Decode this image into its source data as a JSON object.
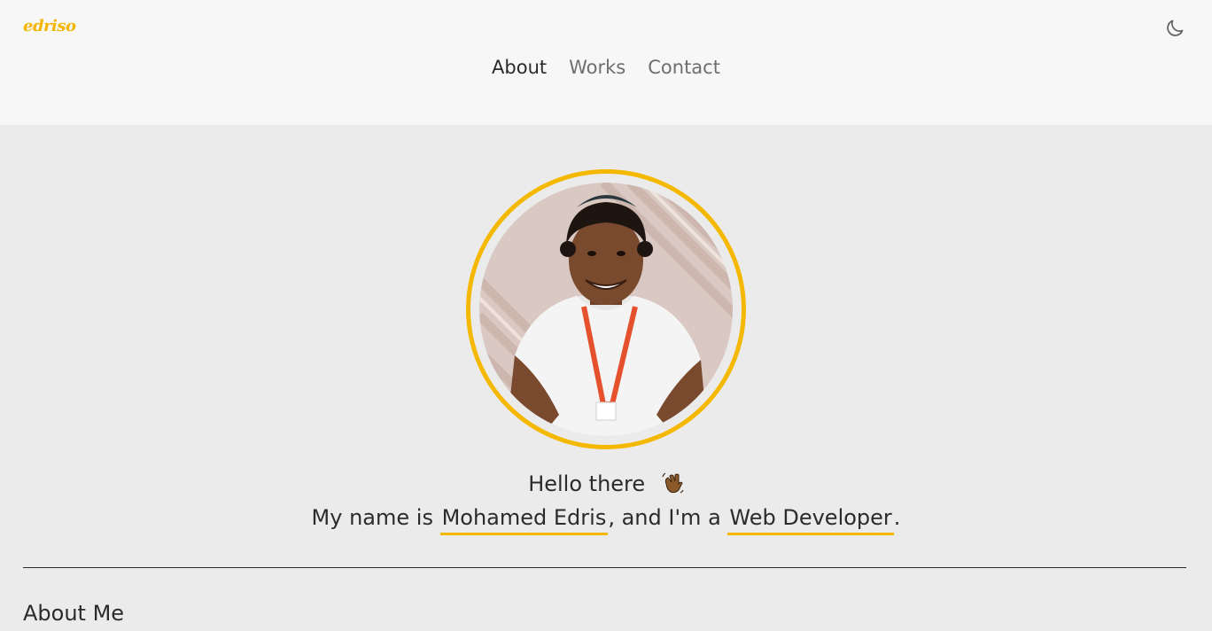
{
  "brand": {
    "logo_text": "edriso",
    "accent_color": "#f5b800"
  },
  "header": {
    "theme_toggle_icon": "moon-icon"
  },
  "nav": {
    "items": [
      {
        "label": "About",
        "active": true
      },
      {
        "label": "Works",
        "active": false
      },
      {
        "label": "Contact",
        "active": false
      }
    ]
  },
  "hero": {
    "avatar_alt": "profile-photo",
    "greeting": "Hello there",
    "greeting_icon": "waving-hand-icon",
    "intro_prefix": "My name is ",
    "name": "Mohamed Edris",
    "intro_middle": ", and I'm a ",
    "role": "Web Developer",
    "intro_suffix": "."
  },
  "about": {
    "title": "About Me"
  }
}
